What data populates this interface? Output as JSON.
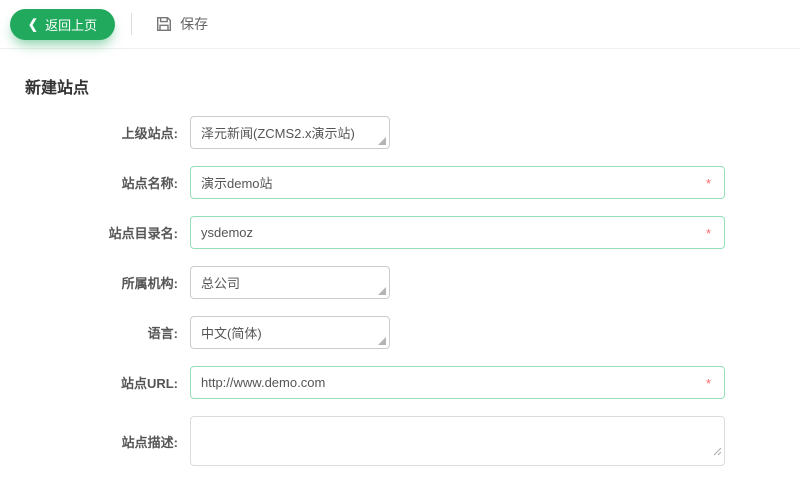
{
  "toolbar": {
    "back_label": "返回上页",
    "back_chevron": "❮",
    "save_label": "保存"
  },
  "page": {
    "title": "新建站点"
  },
  "form": {
    "fields": [
      {
        "type": "select",
        "label": "上级站点:",
        "value": "泽元新闻(ZCMS2.x演示站)",
        "required": false
      },
      {
        "type": "text",
        "label": "站点名称:",
        "value": "演示demo站",
        "required": true
      },
      {
        "type": "text",
        "label": "站点目录名:",
        "value": "ysdemoz",
        "required": true
      },
      {
        "type": "select",
        "label": "所属机构:",
        "value": "总公司",
        "required": false
      },
      {
        "type": "select",
        "label": "语言:",
        "value": "中文(简体)",
        "required": false
      },
      {
        "type": "text",
        "label": "站点URL:",
        "value": "http://www.demo.com",
        "required": true
      },
      {
        "type": "textarea",
        "label": "站点描述:",
        "value": "",
        "required": false
      }
    ],
    "required_marker": "*"
  },
  "colors": {
    "accent_green": "#21a95e",
    "required_border_green": "#95dfb8",
    "asterisk_red": "#f56c6c",
    "control_border_gray": "#cccccc"
  }
}
